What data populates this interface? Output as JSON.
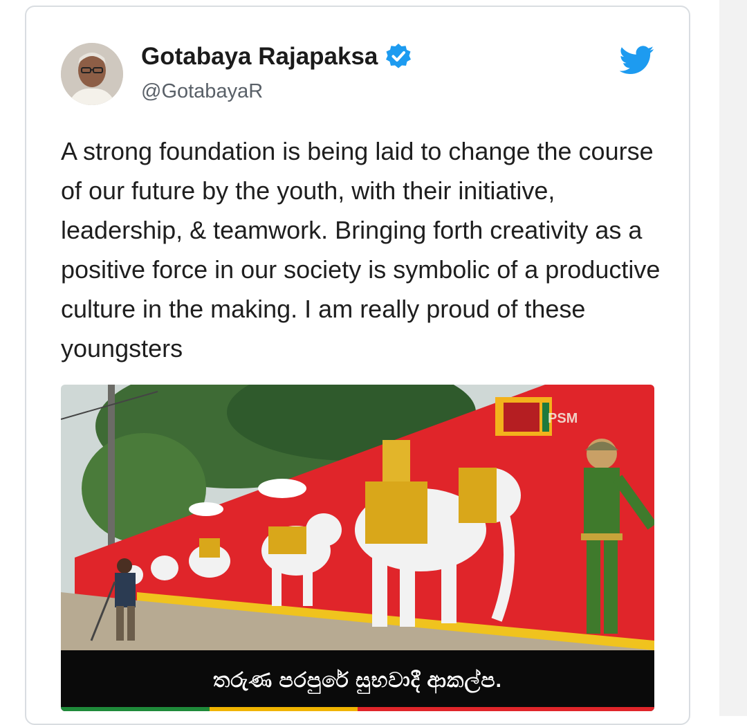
{
  "tweet": {
    "author_name": "Gotabaya Rajapaksa",
    "handle": "@GotabayaR",
    "text": "A strong foundation is being laid to change the course of our future by the youth, with their initiative, leadership, & teamwork. Bringing forth creativity as a positive force in our society is symbolic of a productive culture in the making. I am really proud of these youngsters",
    "verified": true
  },
  "media": {
    "subtitle": "තරුණ පරපුරේ සුභවාදී ආකල්ප.",
    "watermark": "PSM"
  },
  "icons": {
    "verified": "verified-badge-icon",
    "brand": "twitter-bird-icon"
  },
  "colors": {
    "twitter_blue": "#1d9bf0",
    "wall_red": "#e0252a",
    "caption_bg": "#0a0a0a"
  }
}
